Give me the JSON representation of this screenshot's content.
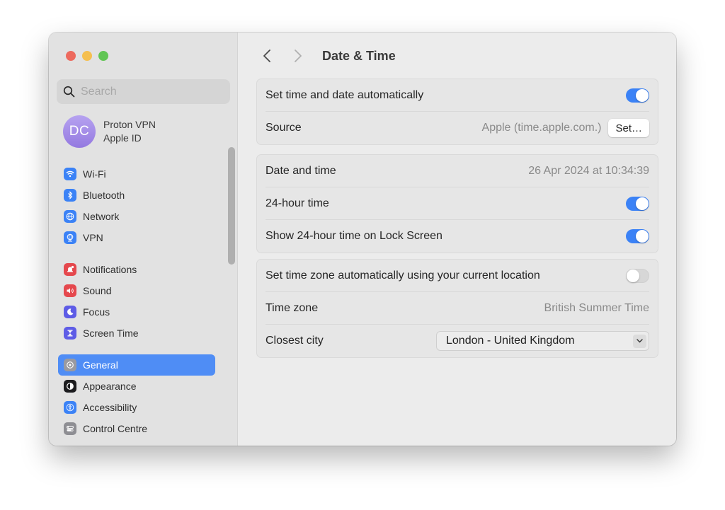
{
  "window": {
    "traffic_lights": [
      "close",
      "minimize",
      "zoom"
    ]
  },
  "sidebar": {
    "search": {
      "placeholder": "Search",
      "value": ""
    },
    "account": {
      "initials": "DC",
      "name": "Proton VPN",
      "subtitle": "Apple ID"
    },
    "groups": [
      [
        {
          "label": "Wi-Fi",
          "icon": "wifi-icon",
          "color": "#3b82f6"
        },
        {
          "label": "Bluetooth",
          "icon": "bluetooth-icon",
          "color": "#3b82f6"
        },
        {
          "label": "Network",
          "icon": "globe-icon",
          "color": "#3b82f6"
        },
        {
          "label": "VPN",
          "icon": "vpn-globe-icon",
          "color": "#3b82f6"
        }
      ],
      [
        {
          "label": "Notifications",
          "icon": "bell-icon",
          "color": "#e5484d"
        },
        {
          "label": "Sound",
          "icon": "speaker-icon",
          "color": "#e5484d"
        },
        {
          "label": "Focus",
          "icon": "moon-icon",
          "color": "#5e5ce6"
        },
        {
          "label": "Screen Time",
          "icon": "hourglass-icon",
          "color": "#5e5ce6"
        }
      ],
      [
        {
          "label": "General",
          "icon": "gear-icon",
          "color": "#8e8e93",
          "selected": true
        },
        {
          "label": "Appearance",
          "icon": "appearance-icon",
          "color": "#1c1c1e"
        },
        {
          "label": "Accessibility",
          "icon": "accessibility-icon",
          "color": "#3b82f6"
        },
        {
          "label": "Control Centre",
          "icon": "control-centre-icon",
          "color": "#8e8e93"
        }
      ]
    ]
  },
  "header": {
    "title": "Date & Time",
    "back_label": "Back",
    "forward_label": "Forward"
  },
  "groups": {
    "auto": {
      "set_auto_label": "Set time and date automatically",
      "set_auto_on": true,
      "source_label": "Source",
      "source_value": "Apple (time.apple.com.)",
      "set_button": "Set…"
    },
    "datetime": {
      "date_label": "Date and time",
      "date_value": "26 Apr 2024 at 10:34:39",
      "h24_label": "24-hour time",
      "h24_on": true,
      "lock_label": "Show 24-hour time on Lock Screen",
      "lock_on": true
    },
    "timezone": {
      "auto_tz_label": "Set time zone automatically using your current location",
      "auto_tz_on": false,
      "tz_label": "Time zone",
      "tz_value": "British Summer Time",
      "city_label": "Closest city",
      "city_value": "London - United Kingdom"
    }
  },
  "help": {
    "label": "?"
  },
  "colors": {
    "accent": "#3b82f6",
    "selection": "#4f8df5"
  }
}
